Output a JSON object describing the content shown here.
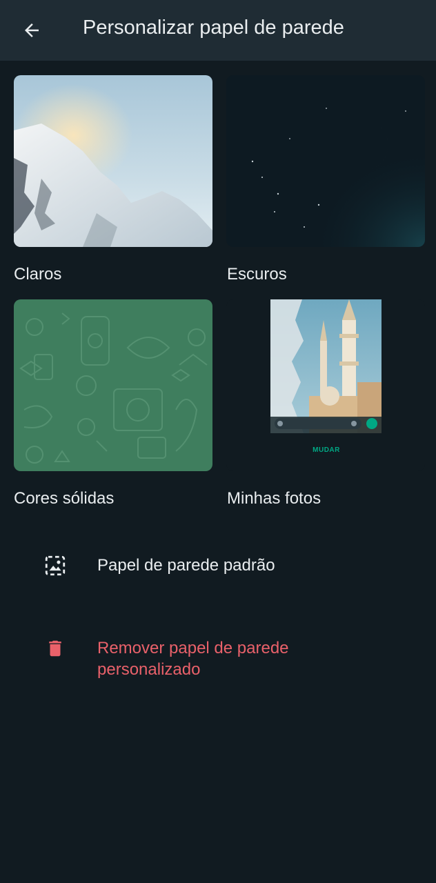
{
  "appbar": {
    "title": "Personalizar papel de parede",
    "back_icon": "arrow-left-icon"
  },
  "categories": [
    {
      "label": "Claros",
      "thumbnail": "snowy-mountain-image"
    },
    {
      "label": "Escuros",
      "thumbnail": "night-sky-moon-image"
    },
    {
      "label": "Cores sólidas",
      "thumbnail": "green-doodle-pattern-image"
    },
    {
      "label": "Minhas fotos",
      "thumbnail": "mosque-photo-preview",
      "action_label": "MUDAR"
    }
  ],
  "options": {
    "default": {
      "label": "Papel de parede padrão",
      "icon": "wallpaper-icon"
    },
    "remove": {
      "label_line1": "Remover papel de parede",
      "label_line2": "personalizado",
      "icon": "trash-icon"
    }
  },
  "colors": {
    "background": "#111b21",
    "appbar": "#1f2c34",
    "text": "#e9edef",
    "danger": "#e9616a",
    "accent": "#00a884"
  }
}
